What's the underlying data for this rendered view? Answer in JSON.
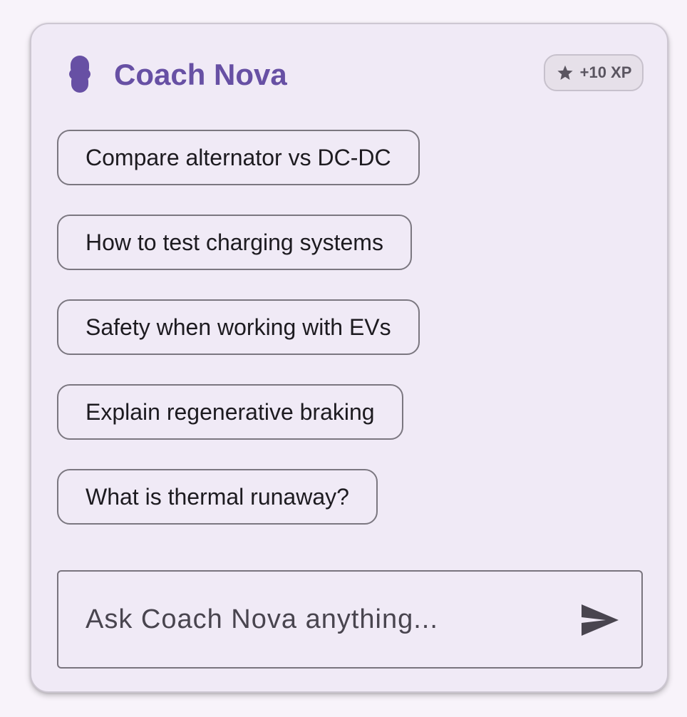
{
  "header": {
    "title": "Coach Nova",
    "avatar_icon": "coach-avatar-icon",
    "xp_badge": {
      "icon": "star-icon",
      "label": "+10 XP"
    }
  },
  "suggestions": [
    {
      "label": "Compare alternator vs DC-DC"
    },
    {
      "label": "How to test charging systems"
    },
    {
      "label": "Safety when working with EVs"
    },
    {
      "label": "Explain regenerative braking"
    },
    {
      "label": "What is thermal runaway?"
    }
  ],
  "input": {
    "placeholder": "Ask Coach Nova anything...",
    "value": "",
    "send_icon": "send-icon"
  },
  "colors": {
    "accent": "#6750a4",
    "card_background": "#f0eaf6",
    "page_background": "#f8f3fa",
    "chip_border": "#7b7780",
    "text": "#1d1b20"
  }
}
